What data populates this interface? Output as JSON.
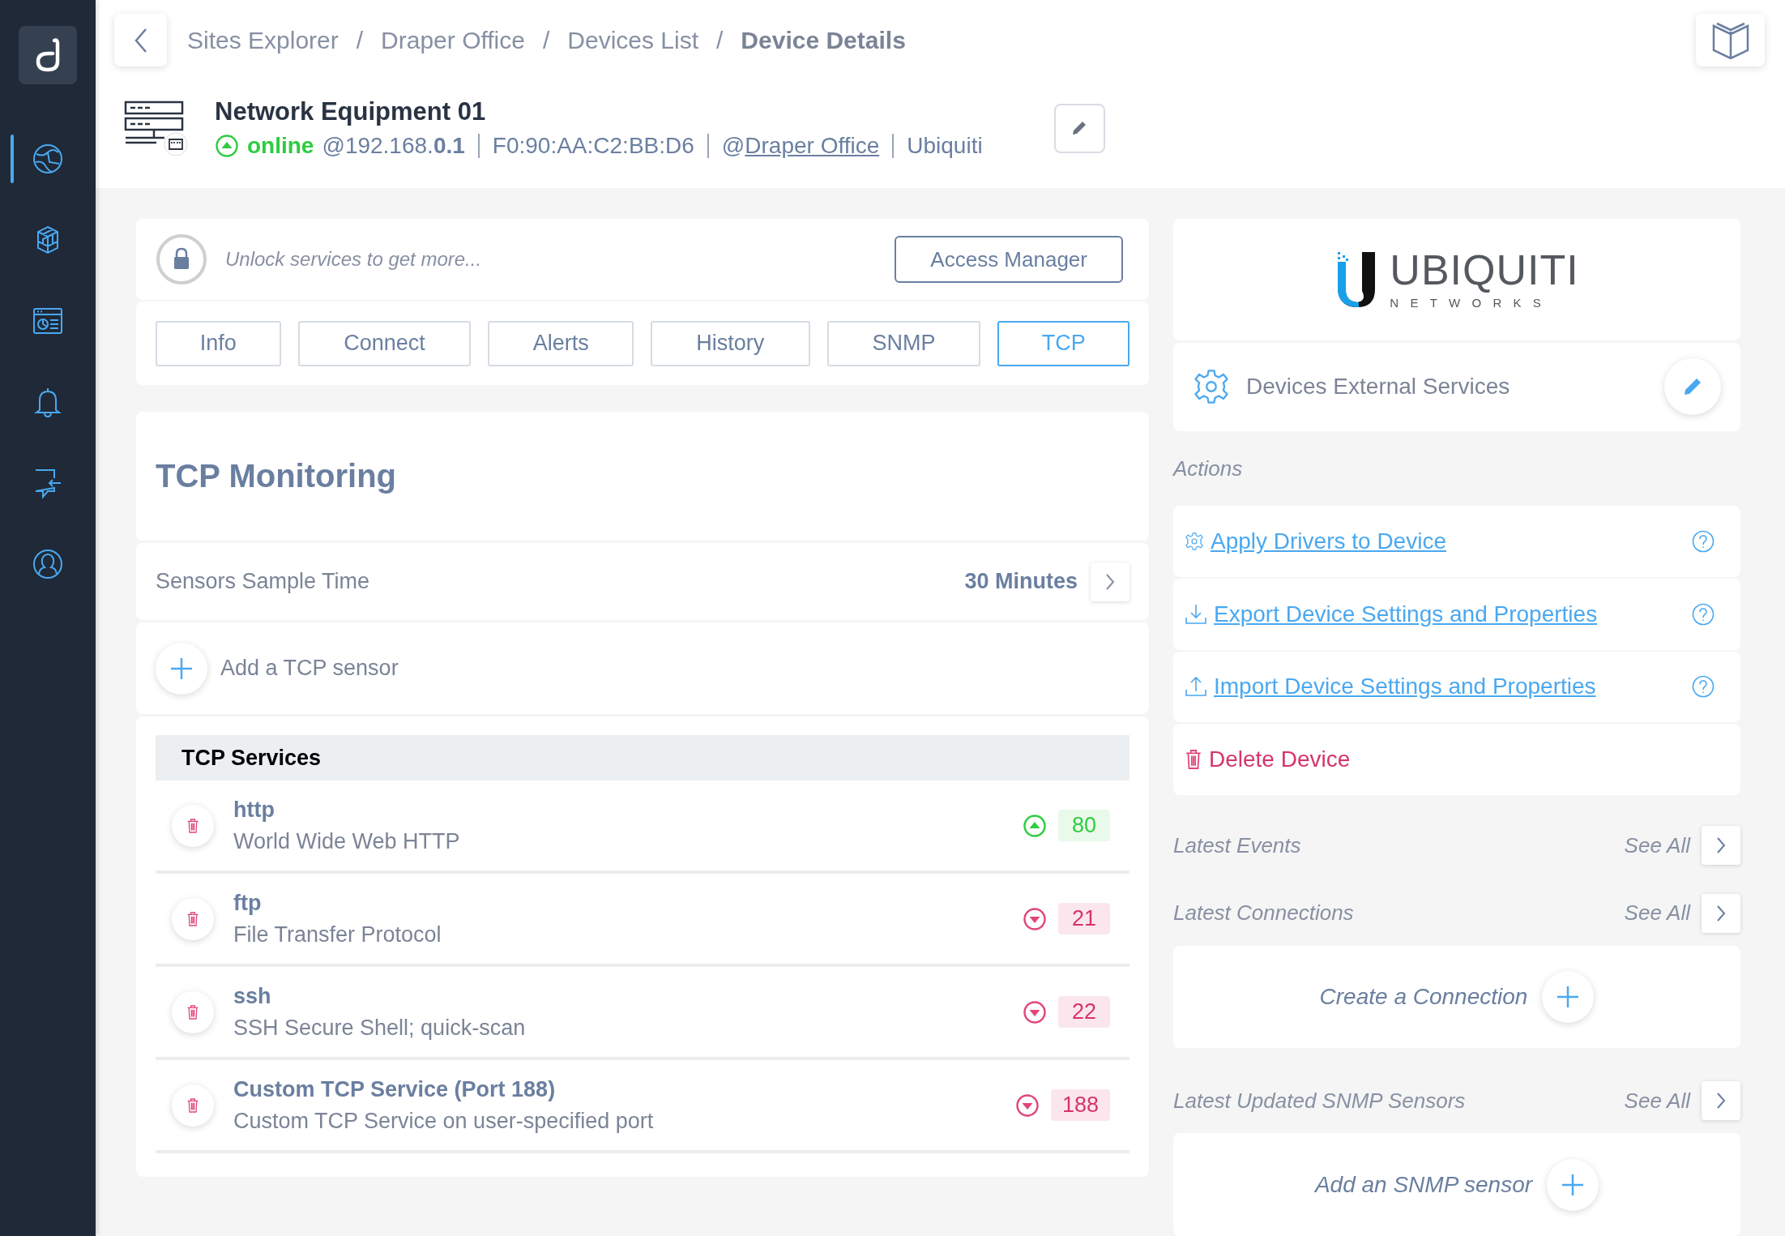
{
  "sidebar": {
    "items": [
      {
        "kind": "globe",
        "selected": true
      },
      {
        "kind": "cubes",
        "selected": false
      },
      {
        "kind": "dashboard",
        "selected": false
      },
      {
        "kind": "bell",
        "selected": false
      },
      {
        "kind": "import",
        "selected": false
      },
      {
        "kind": "user",
        "selected": false
      }
    ]
  },
  "breadcrumb": [
    {
      "label": "Sites Explorer",
      "current": false
    },
    {
      "separator": "/",
      "label": "Draper Office",
      "current": false
    },
    {
      "separator": "/",
      "label": "Devices List",
      "current": false
    },
    {
      "separator": "/",
      "label": "Device Details",
      "current": true
    }
  ],
  "device": {
    "name": "Network Equipment 01",
    "status": {
      "label": "online",
      "up": true
    },
    "ip": "@192.168.**0.1**",
    "mac": "F0:90:AA:C2:BB:D6",
    "site_prefix": "@",
    "site": "Draper Office",
    "vendor": "Ubiquiti"
  },
  "unlock": {
    "text": "Unlock services to get more...",
    "button": "Access Manager"
  },
  "tabs": [
    {
      "label": "Info",
      "selected": false
    },
    {
      "label": "Connect",
      "selected": false
    },
    {
      "label": "Alerts",
      "selected": false
    },
    {
      "label": "History",
      "selected": false
    },
    {
      "label": "SNMP",
      "selected": false
    },
    {
      "label": "TCP",
      "selected": true
    }
  ],
  "monitoring": {
    "title": "TCP Monitoring",
    "sample_time": {
      "label": "Sensors Sample Time",
      "value": "30 Minutes"
    },
    "add_sensor": "Add a TCP sensor",
    "services": {
      "title": "TCP Services",
      "rows": [
        {
          "name": "http",
          "description": "World Wide Web HTTP",
          "port": "80",
          "up": true
        },
        {
          "name": "ftp",
          "description": "File Transfer Protocol",
          "port": "21",
          "up": false
        },
        {
          "name": "ssh",
          "description": "SSH Secure Shell; quick-scan",
          "port": "22",
          "up": false
        },
        {
          "name": "Custom TCP Service (Port 188)",
          "description": "Custom TCP Service on user-specified port",
          "port": "188",
          "up": false
        }
      ]
    }
  },
  "vendor_logo": {
    "name": "UBIQUITI",
    "tagline": "NETWORKS"
  },
  "external_services": {
    "label": "Devices External Services"
  },
  "actions": {
    "title": "Actions",
    "items": [
      {
        "kind": "apply",
        "label": "Apply Drivers to Device"
      },
      {
        "kind": "export",
        "label": "Export Device Settings and Properties"
      },
      {
        "kind": "import",
        "label": "Import Device Settings and Properties"
      },
      {
        "kind": "delete",
        "label": "Delete Device"
      }
    ]
  },
  "sections": [
    {
      "title": "Latest Events",
      "see_all": "See All"
    },
    {
      "title": "Latest Connections",
      "see_all": "See All",
      "empty_action": "Create a Connection"
    },
    {
      "title": "Latest Updated SNMP Sensors",
      "see_all": "See All",
      "empty_action": "Add an SNMP sensor"
    }
  ]
}
